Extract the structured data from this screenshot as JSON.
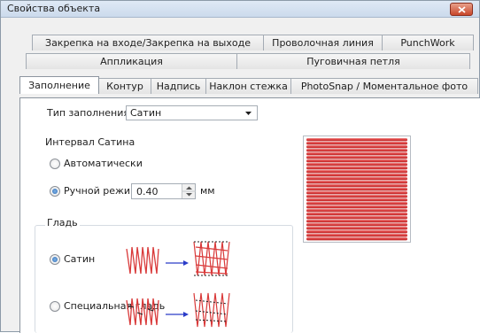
{
  "window": {
    "title": "Свойства объекта"
  },
  "tabs_row1": [
    "Закрепка на входе/Закрепка на выходе",
    "Проволочная линия",
    "PunchWork"
  ],
  "tabs_row2": [
    "Аппликация",
    "Пуговичная петля"
  ],
  "tabs_row3": [
    "Заполнение",
    "Контур",
    "Надпись",
    "Наклон стежка",
    "PhotoSnap / Моментальное фото"
  ],
  "fill": {
    "type_label": "Тип заполнения:",
    "type_value": "Сатин",
    "interval_label": "Интервал Сатина",
    "auto_label": "Автоматически",
    "manual_label": "Ручной режим:",
    "manual_value": "0.40",
    "unit": "мм"
  },
  "smooth": {
    "group_label": "Гладь",
    "option_satin": "Сатин",
    "option_special": "Специальная гладь"
  },
  "colors": {
    "stitch": "#d93a3a",
    "arrow": "#2a3cc8"
  }
}
